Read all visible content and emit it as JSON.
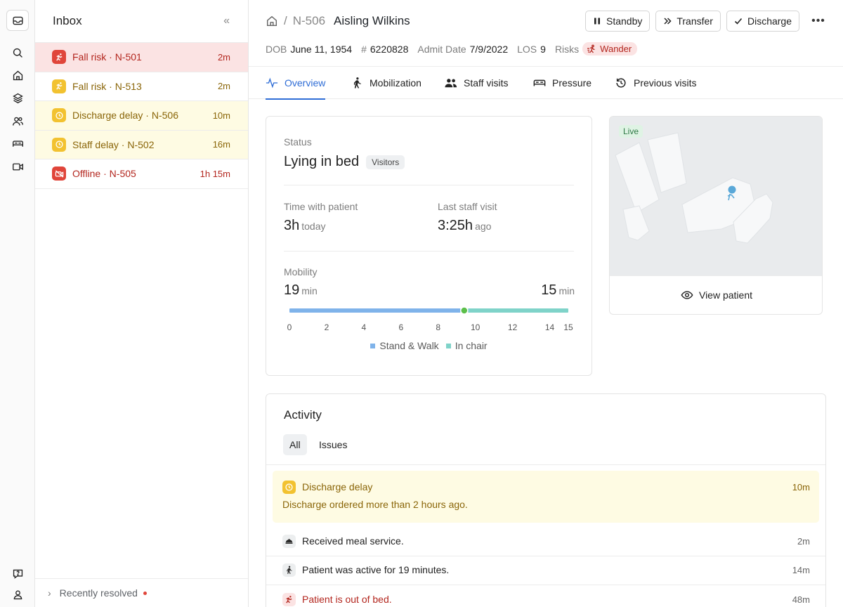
{
  "inbox": {
    "title": "Inbox",
    "items": [
      {
        "kind": "Fall risk",
        "room": "N-501",
        "time": "2m",
        "severity": "red"
      },
      {
        "kind": "Fall risk",
        "room": "N-513",
        "time": "2m",
        "severity": "amber"
      },
      {
        "kind": "Discharge delay",
        "room": "N-506",
        "time": "10m",
        "severity": "amber"
      },
      {
        "kind": "Staff delay",
        "room": "N-502",
        "time": "16m",
        "severity": "amber"
      },
      {
        "kind": "Offline",
        "room": "N-505",
        "time": "1h 15m",
        "severity": "red"
      }
    ],
    "separator": " · ",
    "recently_resolved": "Recently resolved"
  },
  "header": {
    "separator": "/",
    "room": "N-506",
    "patient_name": "Aisling Wilkins",
    "actions": {
      "standby": "Standby",
      "transfer": "Transfer",
      "discharge": "Discharge"
    }
  },
  "meta": {
    "dob_label": "DOB",
    "dob": "June 11, 1954",
    "id_label": "#",
    "id": "6220828",
    "admit_label": "Admit Date",
    "admit": "7/9/2022",
    "los_label": "LOS",
    "los": "9",
    "risks_label": "Risks",
    "risk": "Wander"
  },
  "tabs": [
    "Overview",
    "Mobilization",
    "Staff visits",
    "Pressure",
    "Previous visits"
  ],
  "status": {
    "label": "Status",
    "value": "Lying in bed",
    "chip": "Visitors",
    "time_with_patient_label": "Time with patient",
    "time_with_patient": "3h",
    "time_with_patient_suffix": "today",
    "last_visit_label": "Last staff visit",
    "last_visit": "3:25h",
    "last_visit_suffix": "ago",
    "mobility_label": "Mobility",
    "mobility_left": "19",
    "mobility_right": "15",
    "unit": "min"
  },
  "chart_data": {
    "type": "bar",
    "orientation": "horizontal-segmented",
    "x_ticks": [
      "0",
      "2",
      "4",
      "6",
      "8",
      "10",
      "12",
      "14",
      "15"
    ],
    "xlim": [
      0,
      15
    ],
    "series": [
      {
        "name": "Stand & Walk",
        "start": 0,
        "end": 9.2,
        "color": "#7fb3ea"
      },
      {
        "name": "In chair",
        "start": 9.6,
        "end": 15,
        "color": "#7fd3c9"
      }
    ],
    "marker": 9.4,
    "marker_color": "#5cbf4a"
  },
  "map": {
    "live": "Live",
    "view_patient": "View patient"
  },
  "activity": {
    "title": "Activity",
    "filters": [
      "All",
      "Issues"
    ],
    "highlight": {
      "title": "Discharge delay",
      "time": "10m",
      "detail": "Discharge ordered more than 2 hours ago."
    },
    "rows": [
      {
        "text": "Received meal service.",
        "time": "2m"
      },
      {
        "text": "Patient was active for 19 minutes.",
        "time": "14m"
      },
      {
        "text": "Patient is out of bed.",
        "time": "48m"
      }
    ]
  },
  "colors": {
    "accent": "#2f6dd6",
    "danger": "#e0453a",
    "warning": "#f2c230",
    "warning_bg": "#fefbe3",
    "danger_bg": "#fbe3e3"
  }
}
